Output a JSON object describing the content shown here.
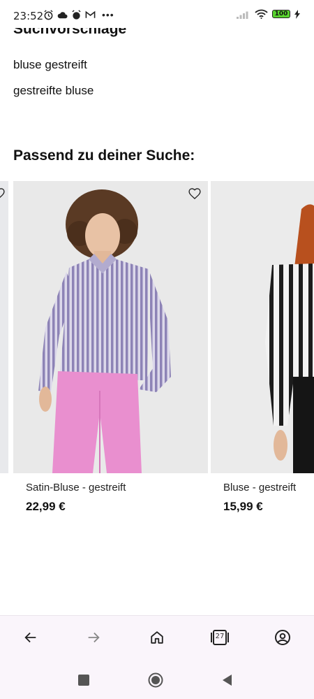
{
  "status": {
    "time": "23:52",
    "battery": "100"
  },
  "suggestions": {
    "title": "Suchvorschläge",
    "items": [
      "bluse gestreift",
      "gestreifte bluse"
    ]
  },
  "section": {
    "title": "Passend zu deiner Suche:"
  },
  "products": [
    {
      "name": "Satin-Bluse - gestreift",
      "price": "22,99 €"
    },
    {
      "name": "Bluse - gestreift",
      "price": "15,99 €"
    }
  ],
  "browser": {
    "tabs_count": "27"
  },
  "icons": {
    "wishlist": "heart-outline-icon",
    "back": "arrow-left-icon",
    "forward": "arrow-right-icon",
    "home": "home-icon",
    "tabs": "tabs-icon",
    "account": "account-circle-icon"
  },
  "colors": {
    "background": "#ffffff",
    "nav_background": "#faf5fb",
    "battery": "#58d32e",
    "pants": "#e98fcf",
    "blouse_stripe": "#8d83b6"
  }
}
